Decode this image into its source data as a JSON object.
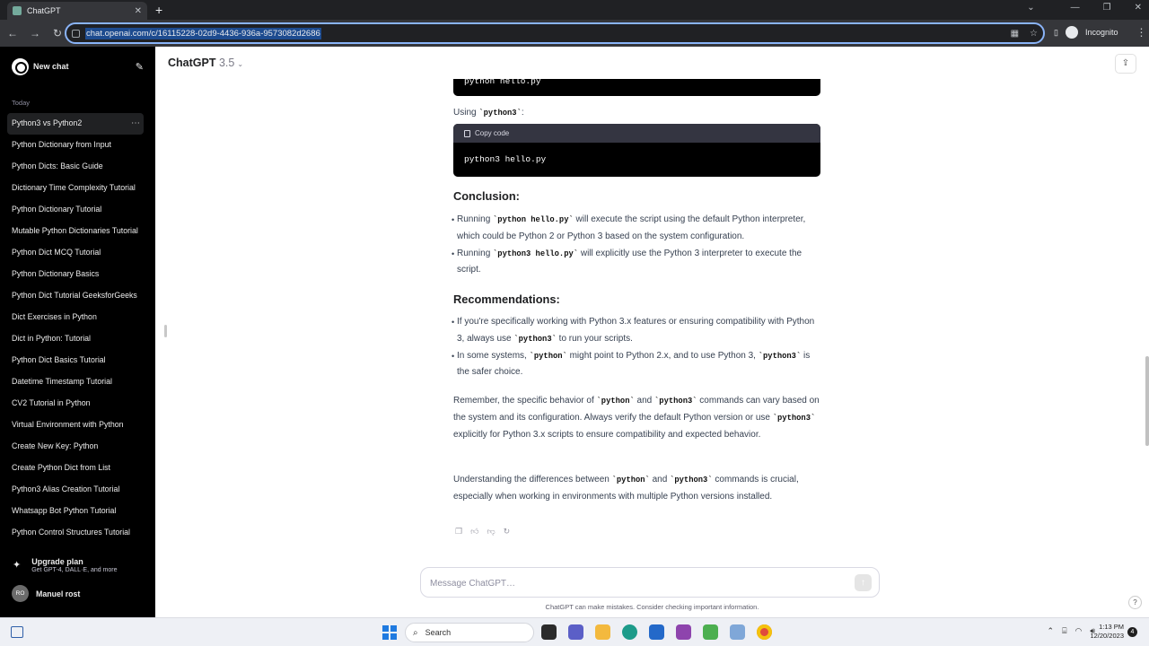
{
  "browser": {
    "tab_title": "ChatGPT",
    "url": "chat.openai.com/c/16115228-02d9-4436-936a-9573082d2686",
    "incognito_label": "Incognito"
  },
  "sidebar": {
    "new_chat": "New chat",
    "section_label": "Today",
    "items": [
      "Python3 vs Python2",
      "Python Dictionary from Input",
      "Python Dicts: Basic Guide",
      "Dictionary Time Complexity Tutorial",
      "Python Dictionary Tutorial",
      "Mutable Python Dictionaries Tutorial",
      "Python Dict MCQ Tutorial",
      "Python Dictionary Basics",
      "Python Dict Tutorial GeeksforGeeks",
      "Dict Exercises in Python",
      "Dict in Python: Tutorial",
      "Python Dict Basics Tutorial",
      "Datetime Timestamp Tutorial",
      "CV2 Tutorial in Python",
      "Virtual Environment with Python",
      "Create New Key: Python",
      "Create Python Dict from List",
      "Python3 Alias Creation Tutorial",
      "Whatsapp Bot Python Tutorial",
      "Python Control Structures Tutorial"
    ],
    "upgrade_title": "Upgrade plan",
    "upgrade_sub": "Get GPT-4, DALL·E, and more",
    "user_initials": "RO",
    "user_name": "Manuel rost"
  },
  "header": {
    "model_name": "ChatGPT",
    "model_version": "3.5"
  },
  "message": {
    "code_top": "python hello.py",
    "using_prefix": "Using ",
    "using_code": "`python3`",
    "using_suffix": ":",
    "copy_code": "Copy code",
    "code_block": "python3 hello.py",
    "conclusion_heading": "Conclusion:",
    "conclusion": [
      {
        "a": "Running ",
        "code": "`python hello.py`",
        "b": " will execute the script using the default Python interpreter, which could be Python 2 or Python 3 based on the system configuration."
      },
      {
        "a": "Running ",
        "code": "`python3 hello.py`",
        "b": " will explicitly use the Python 3 interpreter to execute the script."
      }
    ],
    "recommend_heading": "Recommendations:",
    "rec1": {
      "a": "If you're specifically working with Python 3.x features or ensuring compatibility with Python 3, always use ",
      "code": "`python3`",
      "b": " to run your scripts."
    },
    "rec2": {
      "a": "In some systems, ",
      "code1": "`python`",
      "b": " might point to Python 2.x, and to use Python 3, ",
      "code2": "`python3`",
      "c": " is the safer choice."
    },
    "para1": {
      "a": "Remember, the specific behavior of ",
      "code1": "`python`",
      "b": " and ",
      "code2": "`python3`",
      "c": " commands can vary based on the system and its configuration. Always verify the default Python version or use ",
      "code3": "`python3`",
      "d": " explicitly for Python 3.x scripts to ensure compatibility and expected behavior."
    },
    "para2": {
      "a": "Understanding the differences between ",
      "code1": "`python`",
      "b": " and ",
      "code2": "`python3`",
      "c": " commands is crucial, especially when working in environments with multiple Python versions installed."
    }
  },
  "composer": {
    "placeholder": "Message ChatGPT…",
    "disclaimer": "ChatGPT can make mistakes. Consider checking important information."
  },
  "taskbar": {
    "search_label": "Search",
    "time": "1:13 PM",
    "date": "12/20/2023",
    "notification_count": "4"
  }
}
